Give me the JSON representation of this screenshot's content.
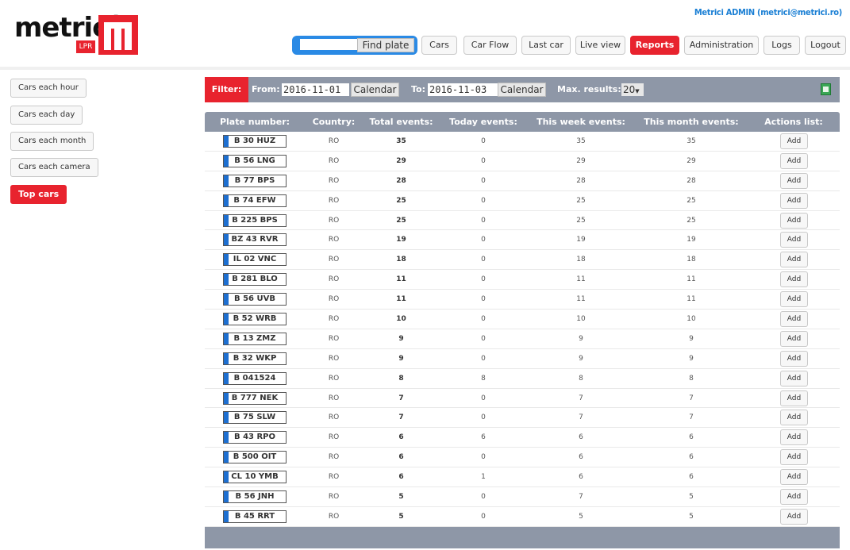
{
  "header": {
    "logo_text": "metricí",
    "logo_sub": "LPR",
    "admin_link": "Metrici ADMIN (metrici@metrici.ro)",
    "search_value": "",
    "find_label": "Find plate",
    "nav": [
      "Cars",
      "Car Flow",
      "Last car",
      "Live view",
      "Reports",
      "Administration",
      "Logs",
      "Logout"
    ],
    "nav_active": "Reports"
  },
  "sidebar": {
    "items": [
      "Cars each hour",
      "Cars each day",
      "Cars each month",
      "Cars each camera",
      "Top cars"
    ],
    "active": "Top cars"
  },
  "filter": {
    "label": "Filter:",
    "from_label": "From:",
    "from_value": "2016-11-01",
    "to_label": "To:",
    "to_value": "2016-11-03",
    "calendar_label": "Calendar",
    "max_label": "Max. results:",
    "max_value": "20",
    "export_icon": "excel-icon"
  },
  "table": {
    "columns": [
      "Plate number:",
      "Country:",
      "Total events:",
      "Today events:",
      "This week events:",
      "This month events:",
      "Actions list:"
    ],
    "action_label": "Add",
    "rows": [
      {
        "plate": "B 30 HUZ",
        "country": "RO",
        "total": "35",
        "today": "0",
        "week": "35",
        "month": "35"
      },
      {
        "plate": "B 56 LNG",
        "country": "RO",
        "total": "29",
        "today": "0",
        "week": "29",
        "month": "29"
      },
      {
        "plate": "B 77 BPS",
        "country": "RO",
        "total": "28",
        "today": "0",
        "week": "28",
        "month": "28"
      },
      {
        "plate": "B 74 EFW",
        "country": "RO",
        "total": "25",
        "today": "0",
        "week": "25",
        "month": "25"
      },
      {
        "plate": "B 225 BPS",
        "country": "RO",
        "total": "25",
        "today": "0",
        "week": "25",
        "month": "25"
      },
      {
        "plate": "BZ 43 RVR",
        "country": "RO",
        "total": "19",
        "today": "0",
        "week": "19",
        "month": "19"
      },
      {
        "plate": "IL 02 VNC",
        "country": "RO",
        "total": "18",
        "today": "0",
        "week": "18",
        "month": "18"
      },
      {
        "plate": "B 281 BLO",
        "country": "RO",
        "total": "11",
        "today": "0",
        "week": "11",
        "month": "11"
      },
      {
        "plate": "B 56 UVB",
        "country": "RO",
        "total": "11",
        "today": "0",
        "week": "11",
        "month": "11"
      },
      {
        "plate": "B 52 WRB",
        "country": "RO",
        "total": "10",
        "today": "0",
        "week": "10",
        "month": "10"
      },
      {
        "plate": "B 13 ZMZ",
        "country": "RO",
        "total": "9",
        "today": "0",
        "week": "9",
        "month": "9"
      },
      {
        "plate": "B 32 WKP",
        "country": "RO",
        "total": "9",
        "today": "0",
        "week": "9",
        "month": "9"
      },
      {
        "plate": "B 041524",
        "country": "RO",
        "total": "8",
        "today": "8",
        "week": "8",
        "month": "8"
      },
      {
        "plate": "B 777 NEK",
        "country": "RO",
        "total": "7",
        "today": "0",
        "week": "7",
        "month": "7"
      },
      {
        "plate": "B 75 SLW",
        "country": "RO",
        "total": "7",
        "today": "0",
        "week": "7",
        "month": "7"
      },
      {
        "plate": "B 43 RPO",
        "country": "RO",
        "total": "6",
        "today": "6",
        "week": "6",
        "month": "6"
      },
      {
        "plate": "B 500 OIT",
        "country": "RO",
        "total": "6",
        "today": "0",
        "week": "6",
        "month": "6"
      },
      {
        "plate": "CL 10 YMB",
        "country": "RO",
        "total": "6",
        "today": "1",
        "week": "6",
        "month": "6"
      },
      {
        "plate": "B 56 JNH",
        "country": "RO",
        "total": "5",
        "today": "0",
        "week": "7",
        "month": "5"
      },
      {
        "plate": "B 45 RRT",
        "country": "RO",
        "total": "5",
        "today": "0",
        "week": "5",
        "month": "5"
      }
    ]
  },
  "colors": {
    "accent_red": "#e8232e",
    "header_gray": "#8e97a7",
    "link_blue": "#1a7fd4",
    "plate_strip_blue": "#1d6fd1"
  }
}
